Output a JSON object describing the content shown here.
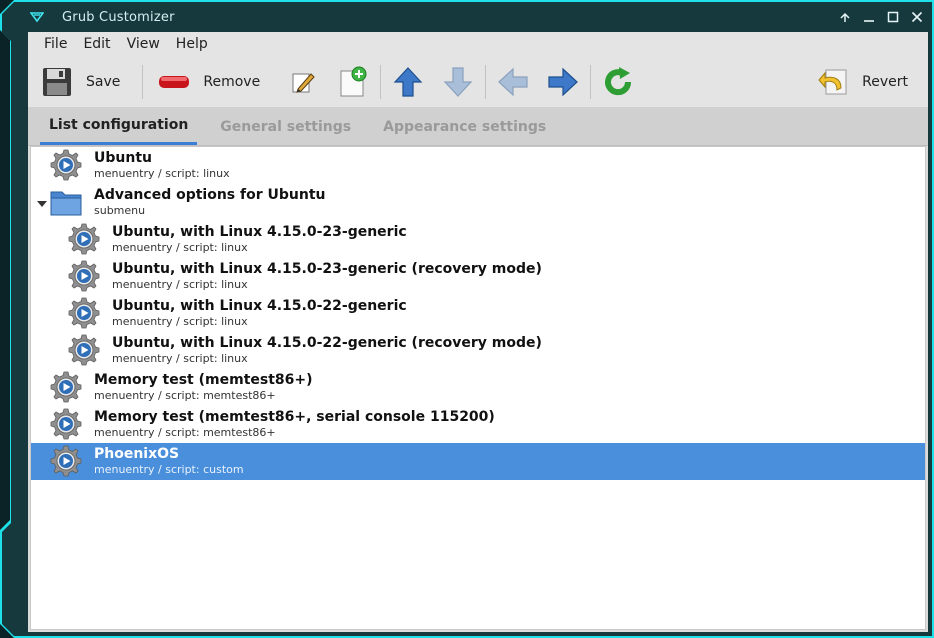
{
  "window": {
    "title": "Grub Customizer"
  },
  "menubar": [
    "File",
    "Edit",
    "View",
    "Help"
  ],
  "toolbar": {
    "save_label": "Save",
    "remove_label": "Remove",
    "revert_label": "Revert"
  },
  "tabs": [
    {
      "label": "List configuration",
      "active": true
    },
    {
      "label": "General settings",
      "active": false
    },
    {
      "label": "Appearance settings",
      "active": false
    }
  ],
  "entries": [
    {
      "name": "Ubuntu",
      "sub": "menuentry / script: linux",
      "level": 0,
      "kind": "entry",
      "selected": false
    },
    {
      "name": "Advanced options for Ubuntu",
      "sub": "submenu",
      "level": 0,
      "kind": "submenu",
      "selected": false
    },
    {
      "name": "Ubuntu, with Linux 4.15.0-23-generic",
      "sub": "menuentry / script: linux",
      "level": 1,
      "kind": "entry",
      "selected": false
    },
    {
      "name": "Ubuntu, with Linux 4.15.0-23-generic (recovery mode)",
      "sub": "menuentry / script: linux",
      "level": 1,
      "kind": "entry",
      "selected": false
    },
    {
      "name": "Ubuntu, with Linux 4.15.0-22-generic",
      "sub": "menuentry / script: linux",
      "level": 1,
      "kind": "entry",
      "selected": false
    },
    {
      "name": "Ubuntu, with Linux 4.15.0-22-generic (recovery mode)",
      "sub": "menuentry / script: linux",
      "level": 1,
      "kind": "entry",
      "selected": false
    },
    {
      "name": "Memory test (memtest86+)",
      "sub": "menuentry / script: memtest86+",
      "level": 0,
      "kind": "entry",
      "selected": false
    },
    {
      "name": "Memory test (memtest86+, serial console 115200)",
      "sub": "menuentry / script: memtest86+",
      "level": 0,
      "kind": "entry",
      "selected": false
    },
    {
      "name": "PhoenixOS",
      "sub": "menuentry / script: custom",
      "level": 0,
      "kind": "entry",
      "selected": true
    }
  ]
}
